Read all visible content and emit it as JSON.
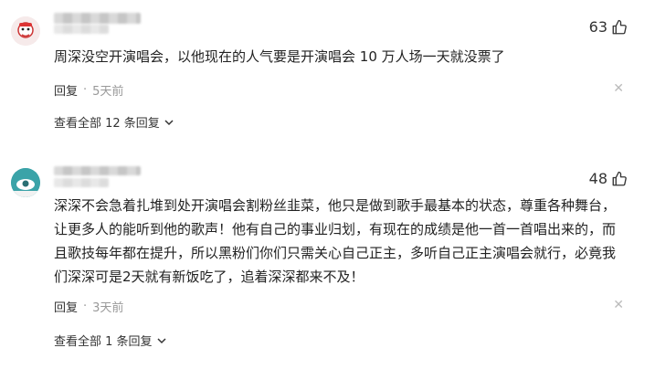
{
  "comments": [
    {
      "likes": "63",
      "text": "周深没空开演唱会，以他现在的人气要是开演唱会 10 万人场一天就没票了",
      "reply_label": "回复",
      "time": "5天前",
      "view_all": "查看全部 12 条回复"
    },
    {
      "likes": "48",
      "text": "深深不会急着扎堆到处开演唱会割粉丝韭菜，他只是做到歌手最基本的状态，尊重各种舞台，让更多人的能听到他的歌声！他有自己的事业归划，有现在的成绩是他一首一首唱出来的，而且歌技每年都在提升，所以黑粉们你们只需关心自己正主，多听自己正主演唱会就行，必竟我们深深可是2天就有新饭吃了，追着深深都来不及！",
      "reply_label": "回复",
      "time": "3天前",
      "view_all": "查看全部 1 条回复"
    }
  ],
  "colors": {
    "avatar1_bg": "#f3e6e6",
    "avatar2_bg": "#3aa3a8",
    "text": "#222222",
    "muted": "#999999"
  },
  "icons": [
    "thumbs-up-icon",
    "close-icon",
    "chevron-down-icon"
  ]
}
